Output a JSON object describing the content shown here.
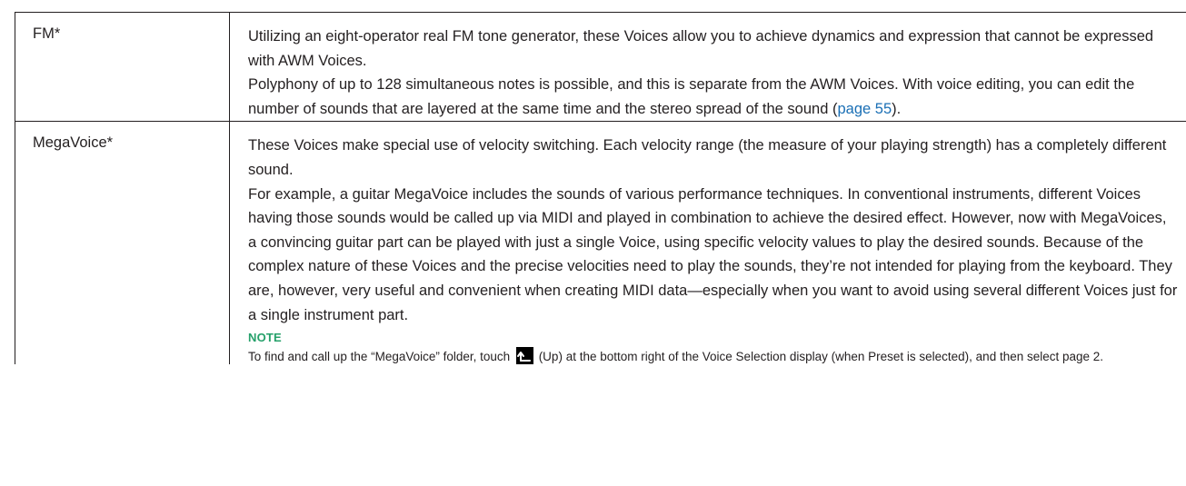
{
  "rows": [
    {
      "type": "FM*",
      "paragraphs": [
        "Utilizing an eight-operator real FM tone generator, these Voices allow you to achieve dynamics and expression that cannot be expressed with AWM Voices.",
        "Polyphony of up to 128 simultaneous notes is possible, and this is separate from the AWM Voices. With voice editing, you can edit the number of sounds that are layered at the same time and the stereo spread of the sound ("
      ],
      "link_text": "page 55",
      "after_link": ")."
    },
    {
      "type": "MegaVoice*",
      "paragraphs": [
        "These Voices make special use of velocity switching. Each velocity range (the measure of your playing strength) has a completely different sound.",
        "For example, a guitar MegaVoice includes the sounds of various performance techniques. In conventional instruments, different Voices having those sounds would be called up via MIDI and played in combination to achieve the desired effect. However, now with MegaVoices, a convincing guitar part can be played with just a single Voice, using specific velocity values to play the desired sounds. Because of the complex nature of these Voices and the precise velocities need to play the sounds, they’re not intended for playing from the keyboard. They are, however, very useful and convenient when creating MIDI data—especially when you want to avoid using several different Voices just for a single instrument part."
      ],
      "note": {
        "title": "NOTE",
        "before_icon": "To find and call up the  “MegaVoice” folder, touch ",
        "icon": "up-arrow-icon",
        "after_icon": " (Up) at the bottom right of the Voice Selection display (when Preset is selected), and then select page 2."
      }
    }
  ],
  "colors": {
    "text": "#231f20",
    "link": "#1a6fb5",
    "note_title": "#25a06a",
    "border": "#231f20"
  }
}
